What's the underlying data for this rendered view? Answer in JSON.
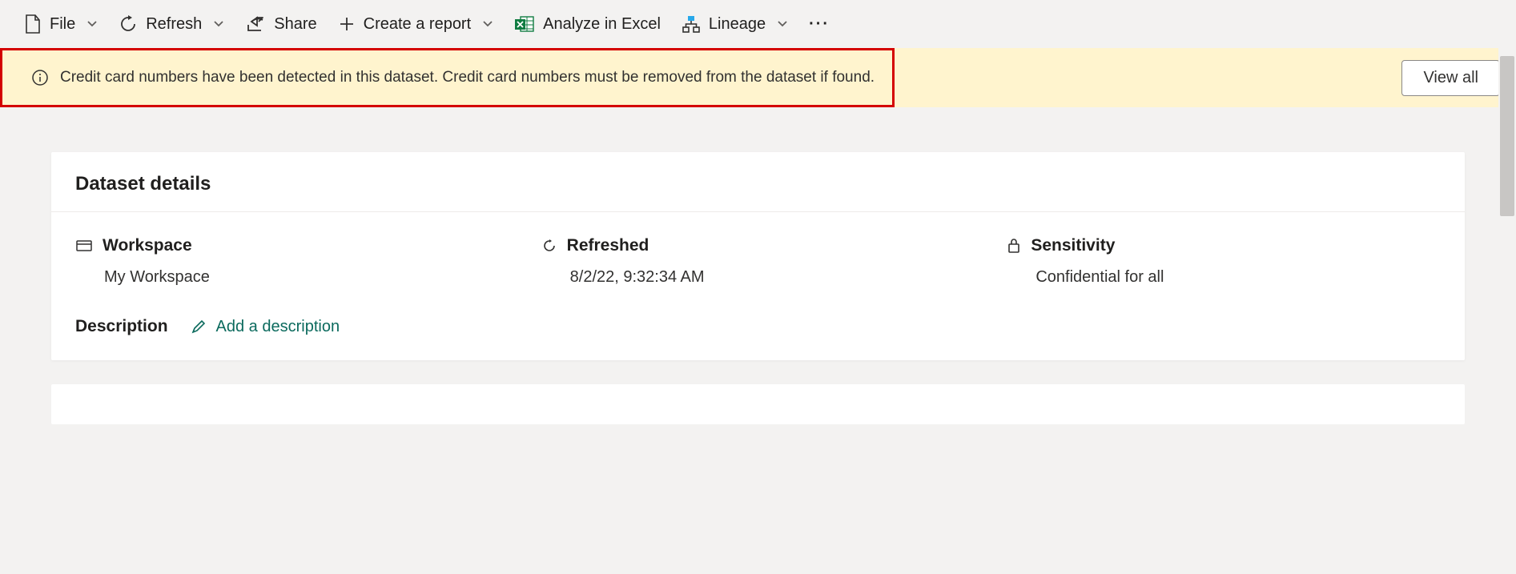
{
  "toolbar": {
    "file": "File",
    "refresh": "Refresh",
    "share": "Share",
    "create_report": "Create a report",
    "analyze_excel": "Analyze in Excel",
    "lineage": "Lineage"
  },
  "banner": {
    "message": "Credit card numbers have been detected in this dataset. Credit card numbers must be removed from the dataset if found.",
    "view_all": "View all"
  },
  "details": {
    "title": "Dataset details",
    "workspace_label": "Workspace",
    "workspace_value": "My Workspace",
    "refreshed_label": "Refreshed",
    "refreshed_value": "8/2/22, 9:32:34 AM",
    "sensitivity_label": "Sensitivity",
    "sensitivity_value": "Confidential for all",
    "description_label": "Description",
    "add_description": "Add a description"
  }
}
